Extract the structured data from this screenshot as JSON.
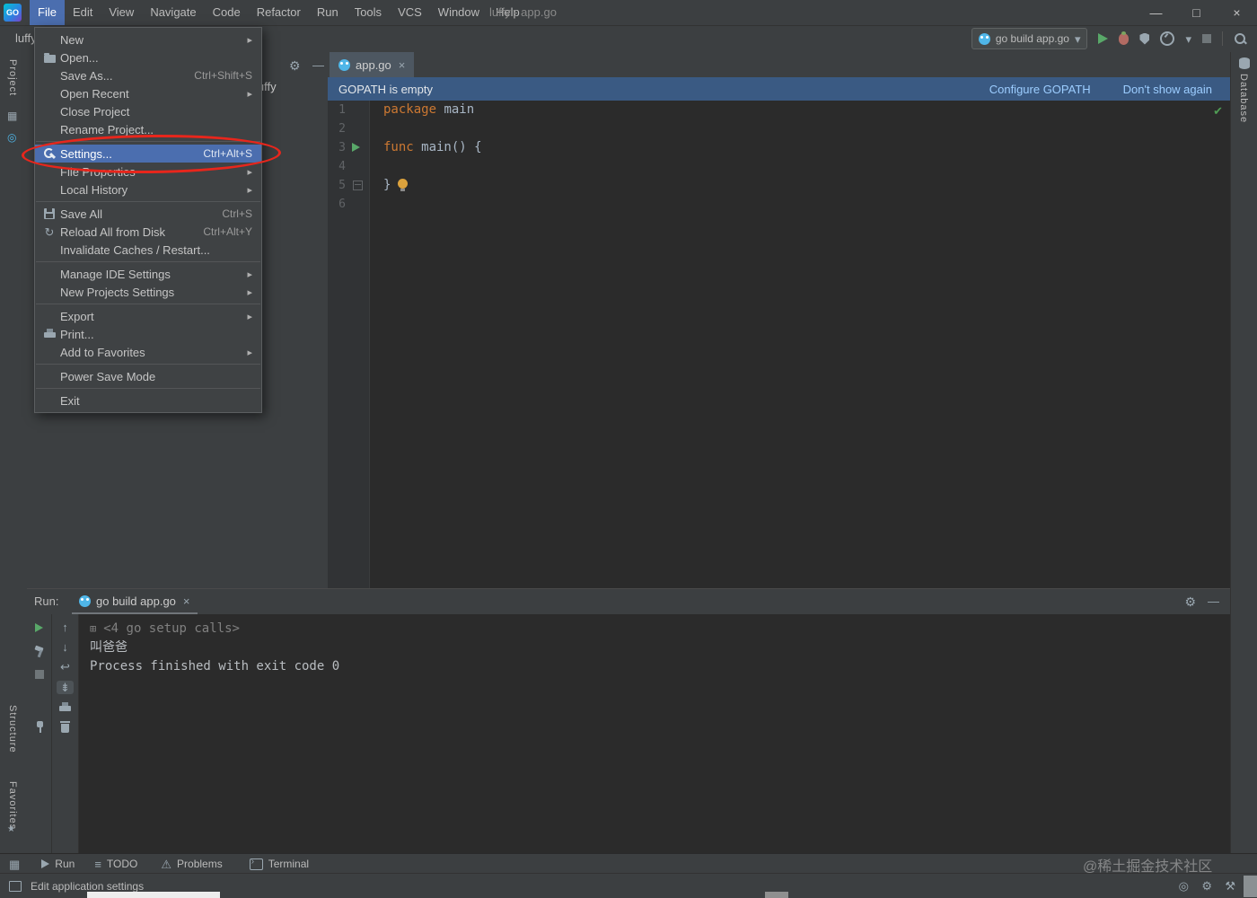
{
  "window": {
    "logo": "GO",
    "title": "luffy - app.go"
  },
  "icons": {
    "minimize": "—",
    "maximize": "□",
    "close": "×",
    "submenu_arrow": "▸",
    "chevron_down": "▾",
    "gear": "⚙",
    "check": "✔",
    "up": "↑",
    "down": "↓",
    "soft_wrap": "↩",
    "scroll_end": "⇟",
    "expand": "⊞",
    "refresh": "↻",
    "grid": "▦",
    "star": "★",
    "todo_list": "≡",
    "warning": "⚠",
    "hammer_pick": "⚒",
    "circle": "◎"
  },
  "menu_bar": {
    "items": [
      "File",
      "Edit",
      "View",
      "Navigate",
      "Code",
      "Refactor",
      "Run",
      "Tools",
      "VCS",
      "Window",
      "Help"
    ]
  },
  "breadcrumb": "luffy",
  "run_toolbar": {
    "config_name": "go build app.go"
  },
  "file_menu": {
    "items": [
      {
        "label": "New",
        "submenu": true
      },
      {
        "label": "Open...",
        "icon": "folder"
      },
      {
        "label": "Save As...",
        "shortcut": "Ctrl+Shift+S"
      },
      {
        "label": "Open Recent",
        "submenu": true
      },
      {
        "label": "Close Project"
      },
      {
        "label": "Rename Project..."
      },
      {
        "label": "Settings...",
        "shortcut": "Ctrl+Alt+S",
        "icon": "wrench",
        "selected": true
      },
      {
        "label": "File Properties",
        "submenu": true
      },
      {
        "label": "Local History",
        "submenu": true
      },
      {
        "label": "Save All",
        "shortcut": "Ctrl+S",
        "icon": "floppy"
      },
      {
        "label": "Reload All from Disk",
        "shortcut": "Ctrl+Alt+Y",
        "icon": "refresh"
      },
      {
        "label": "Invalidate Caches / Restart..."
      },
      {
        "label": "Manage IDE Settings",
        "submenu": true
      },
      {
        "label": "New Projects Settings",
        "submenu": true
      },
      {
        "label": "Export",
        "submenu": true
      },
      {
        "label": "Print...",
        "icon": "printer"
      },
      {
        "label": "Add to Favorites",
        "submenu": true
      },
      {
        "label": "Power Save Mode"
      },
      {
        "label": "Exit"
      }
    ]
  },
  "left_stripe": {
    "project": "Project",
    "structure": "Structure",
    "favorites": "Favorites"
  },
  "right_stripe": {
    "database": "Database"
  },
  "project_panel": {
    "root_item": "luffy"
  },
  "editor": {
    "tab": {
      "label": "app.go"
    },
    "banner": {
      "text": "GOPATH is empty",
      "configure": "Configure GOPATH",
      "dismiss": "Don't show again"
    },
    "lines": [
      {
        "num": "1",
        "code": [
          {
            "t": "package",
            "c": "kw"
          },
          {
            "t": " main",
            "c": "pl"
          }
        ]
      },
      {
        "num": "2"
      },
      {
        "num": "3",
        "code": [
          {
            "t": "func",
            "c": "kw"
          },
          {
            "t": " main() {",
            "c": "pl"
          }
        ]
      },
      {
        "num": "4"
      },
      {
        "num": "5",
        "code": [
          {
            "t": "}",
            "c": "pl"
          }
        ]
      },
      {
        "num": "6"
      }
    ]
  },
  "run_panel": {
    "label": "Run:",
    "tab": {
      "label": "go build app.go"
    },
    "console": {
      "line1": "<4 go setup calls>",
      "line2": "叫爸爸",
      "line3": "Process finished with exit code 0"
    }
  },
  "bottom_bar": {
    "run": "Run",
    "todo": "TODO",
    "problems": "Problems",
    "terminal": "Terminal"
  },
  "status_bar": {
    "message": "Edit application settings"
  },
  "watermark": "@稀土掘金技术社区",
  "colors": {
    "selection_blue": "#4b6eaf",
    "banner_blue": "#3a5a83",
    "link_blue": "#9ccdff",
    "keyword_orange": "#cc7832",
    "code_text": "#a9b7c6",
    "run_green": "#59a869",
    "annotation_red": "#e8261c",
    "editor_bg": "#2b2b2b",
    "panel_bg": "#3c3f41"
  }
}
